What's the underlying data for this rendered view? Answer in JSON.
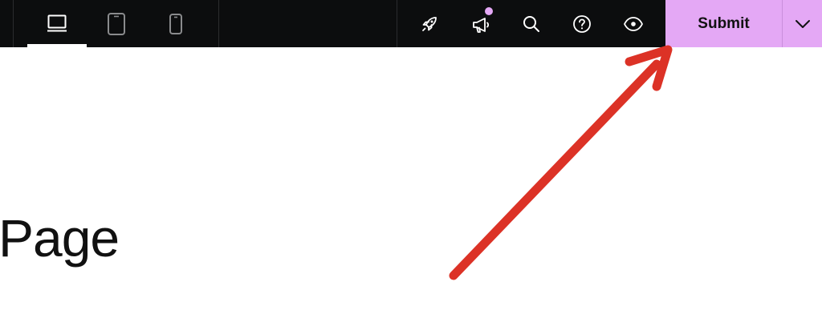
{
  "toolbar": {
    "devices": [
      {
        "name": "desktop",
        "icon": "desktop-icon",
        "active": true
      },
      {
        "name": "tablet",
        "icon": "tablet-icon",
        "active": false
      },
      {
        "name": "mobile",
        "icon": "mobile-icon",
        "active": false
      }
    ],
    "tools": [
      {
        "name": "launch",
        "icon": "rocket-icon"
      },
      {
        "name": "announcements",
        "icon": "megaphone-icon",
        "has_notification": true
      },
      {
        "name": "search",
        "icon": "search-icon"
      },
      {
        "name": "help",
        "icon": "help-circle-icon"
      },
      {
        "name": "preview",
        "icon": "eye-icon"
      }
    ],
    "submit_label": "Submit",
    "dropdown_icon": "chevron-down-icon"
  },
  "page": {
    "title": "Page"
  },
  "annotation": {
    "type": "arrow",
    "points_to": "submit-button",
    "color": "#dc3226"
  },
  "colors": {
    "toolbar_bg": "#0c0d0e",
    "submit_bg": "#e4a8f5",
    "notification_dot": "#e4a8f5",
    "icon": "#ffffff",
    "device_inactive": "#8a8b8d"
  }
}
